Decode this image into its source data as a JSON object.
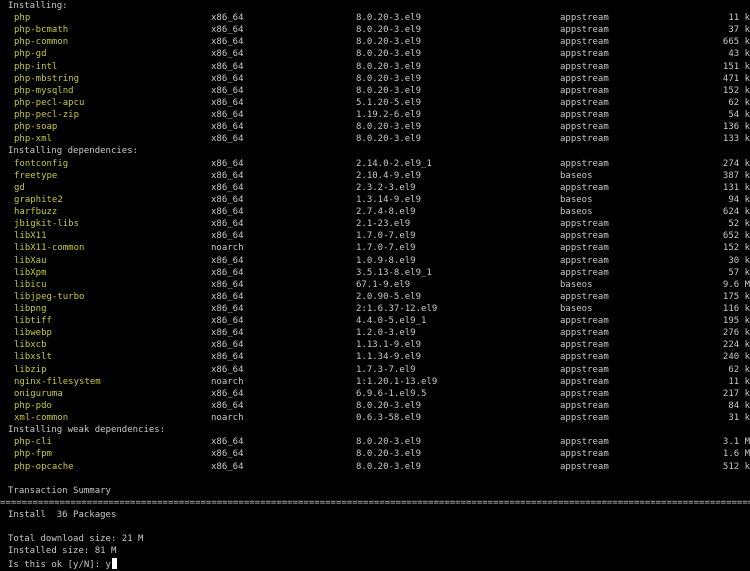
{
  "colors": {
    "background": "#000000",
    "text": "#c8c8c8",
    "package_name": "#c7c738"
  },
  "sections": [
    {
      "heading": "Installing:",
      "packages": [
        {
          "name": "php",
          "arch": "x86_64",
          "version": "8.0.20-3.el9",
          "repo": "appstream",
          "size": "11 k"
        },
        {
          "name": "php-bcmath",
          "arch": "x86_64",
          "version": "8.0.20-3.el9",
          "repo": "appstream",
          "size": "37 k"
        },
        {
          "name": "php-common",
          "arch": "x86_64",
          "version": "8.0.20-3.el9",
          "repo": "appstream",
          "size": "665 k"
        },
        {
          "name": "php-gd",
          "arch": "x86_64",
          "version": "8.0.20-3.el9",
          "repo": "appstream",
          "size": "43 k"
        },
        {
          "name": "php-intl",
          "arch": "x86_64",
          "version": "8.0.20-3.el9",
          "repo": "appstream",
          "size": "151 k"
        },
        {
          "name": "php-mbstring",
          "arch": "x86_64",
          "version": "8.0.20-3.el9",
          "repo": "appstream",
          "size": "471 k"
        },
        {
          "name": "php-mysqlnd",
          "arch": "x86_64",
          "version": "8.0.20-3.el9",
          "repo": "appstream",
          "size": "152 k"
        },
        {
          "name": "php-pecl-apcu",
          "arch": "x86_64",
          "version": "5.1.20-5.el9",
          "repo": "appstream",
          "size": "62 k"
        },
        {
          "name": "php-pecl-zip",
          "arch": "x86_64",
          "version": "1.19.2-6.el9",
          "repo": "appstream",
          "size": "54 k"
        },
        {
          "name": "php-soap",
          "arch": "x86_64",
          "version": "8.0.20-3.el9",
          "repo": "appstream",
          "size": "136 k"
        },
        {
          "name": "php-xml",
          "arch": "x86_64",
          "version": "8.0.20-3.el9",
          "repo": "appstream",
          "size": "133 k"
        }
      ]
    },
    {
      "heading": "Installing dependencies:",
      "packages": [
        {
          "name": "fontconfig",
          "arch": "x86_64",
          "version": "2.14.0-2.el9_1",
          "repo": "appstream",
          "size": "274 k"
        },
        {
          "name": "freetype",
          "arch": "x86_64",
          "version": "2.10.4-9.el9",
          "repo": "baseos",
          "size": "387 k"
        },
        {
          "name": "gd",
          "arch": "x86_64",
          "version": "2.3.2-3.el9",
          "repo": "appstream",
          "size": "131 k"
        },
        {
          "name": "graphite2",
          "arch": "x86_64",
          "version": "1.3.14-9.el9",
          "repo": "baseos",
          "size": "94 k"
        },
        {
          "name": "harfbuzz",
          "arch": "x86_64",
          "version": "2.7.4-8.el9",
          "repo": "baseos",
          "size": "624 k"
        },
        {
          "name": "jbigkit-libs",
          "arch": "x86_64",
          "version": "2.1-23.el9",
          "repo": "appstream",
          "size": "52 k"
        },
        {
          "name": "libX11",
          "arch": "x86_64",
          "version": "1.7.0-7.el9",
          "repo": "appstream",
          "size": "652 k"
        },
        {
          "name": "libX11-common",
          "arch": "noarch",
          "version": "1.7.0-7.el9",
          "repo": "appstream",
          "size": "152 k"
        },
        {
          "name": "libXau",
          "arch": "x86_64",
          "version": "1.0.9-8.el9",
          "repo": "appstream",
          "size": "30 k"
        },
        {
          "name": "libXpm",
          "arch": "x86_64",
          "version": "3.5.13-8.el9_1",
          "repo": "appstream",
          "size": "57 k"
        },
        {
          "name": "libicu",
          "arch": "x86_64",
          "version": "67.1-9.el9",
          "repo": "baseos",
          "size": "9.6 M"
        },
        {
          "name": "libjpeg-turbo",
          "arch": "x86_64",
          "version": "2.0.90-5.el9",
          "repo": "appstream",
          "size": "175 k"
        },
        {
          "name": "libpng",
          "arch": "x86_64",
          "version": "2:1.6.37-12.el9",
          "repo": "baseos",
          "size": "116 k"
        },
        {
          "name": "libtiff",
          "arch": "x86_64",
          "version": "4.4.0-5.el9_1",
          "repo": "appstream",
          "size": "195 k"
        },
        {
          "name": "libwebp",
          "arch": "x86_64",
          "version": "1.2.0-3.el9",
          "repo": "appstream",
          "size": "276 k"
        },
        {
          "name": "libxcb",
          "arch": "x86_64",
          "version": "1.13.1-9.el9",
          "repo": "appstream",
          "size": "224 k"
        },
        {
          "name": "libxslt",
          "arch": "x86_64",
          "version": "1.1.34-9.el9",
          "repo": "appstream",
          "size": "240 k"
        },
        {
          "name": "libzip",
          "arch": "x86_64",
          "version": "1.7.3-7.el9",
          "repo": "appstream",
          "size": "62 k"
        },
        {
          "name": "nginx-filesystem",
          "arch": "noarch",
          "version": "1:1.20.1-13.el9",
          "repo": "appstream",
          "size": "11 k"
        },
        {
          "name": "oniguruma",
          "arch": "x86_64",
          "version": "6.9.6-1.el9.5",
          "repo": "appstream",
          "size": "217 k"
        },
        {
          "name": "php-pdo",
          "arch": "x86_64",
          "version": "8.0.20-3.el9",
          "repo": "appstream",
          "size": "84 k"
        },
        {
          "name": "xml-common",
          "arch": "noarch",
          "version": "0.6.3-58.el9",
          "repo": "appstream",
          "size": "31 k"
        }
      ]
    },
    {
      "heading": "Installing weak dependencies:",
      "packages": [
        {
          "name": "php-cli",
          "arch": "x86_64",
          "version": "8.0.20-3.el9",
          "repo": "appstream",
          "size": "3.1 M"
        },
        {
          "name": "php-fpm",
          "arch": "x86_64",
          "version": "8.0.20-3.el9",
          "repo": "appstream",
          "size": "1.6 M"
        },
        {
          "name": "php-opcache",
          "arch": "x86_64",
          "version": "8.0.20-3.el9",
          "repo": "appstream",
          "size": "512 k"
        }
      ]
    }
  ],
  "summary": {
    "title": "Transaction Summary",
    "separator": "================================================================================================================================================================",
    "install_line": "Install  36 Packages",
    "download_size": "Total download size: 21 M",
    "installed_size": "Installed size: 81 M",
    "prompt": "Is this ok [y/N]: ",
    "answer": "y"
  }
}
